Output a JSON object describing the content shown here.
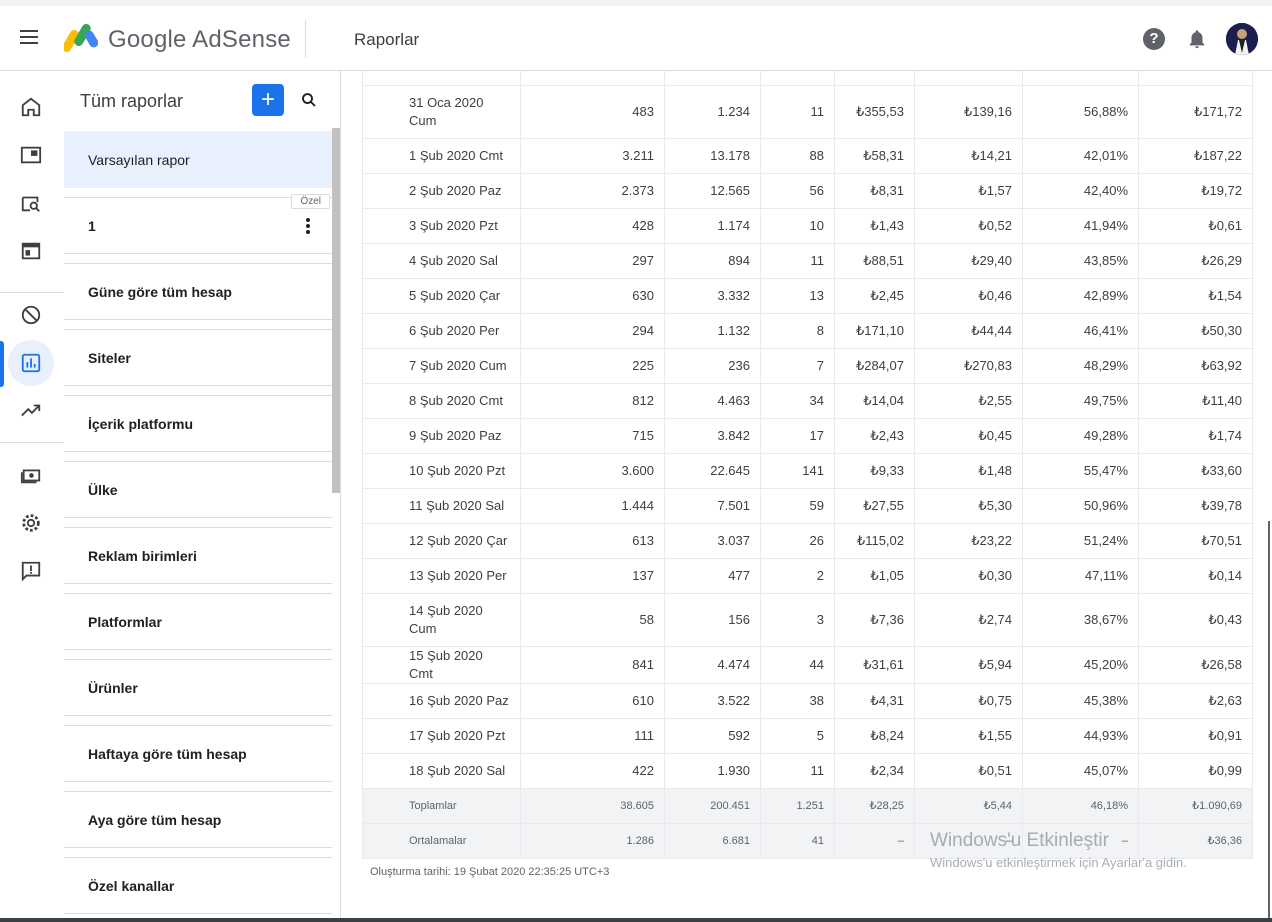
{
  "app": {
    "brand": "Google AdSense",
    "page_title": "Raporlar"
  },
  "icons": {
    "menu": "hamburger-menu-icon",
    "help": "help-icon",
    "notifications": "bell-icon",
    "avatar": "user-avatar"
  },
  "colors": {
    "accent": "#1a73e8",
    "selected_bg": "#e8f0fe",
    "summary_bg": "#f1f3f4"
  },
  "rail": {
    "items": [
      {
        "name": "home-icon"
      },
      {
        "name": "ads-icon"
      },
      {
        "name": "site-management-icon"
      },
      {
        "name": "content-icon"
      },
      {
        "name": "blocking-controls-icon"
      },
      {
        "name": "reports-icon",
        "active": true
      },
      {
        "name": "optimization-icon"
      },
      {
        "name": "payments-icon"
      },
      {
        "name": "settings-icon"
      },
      {
        "name": "feedback-icon"
      }
    ]
  },
  "reports_panel": {
    "title": "Tüm raporlar",
    "add_label": "+",
    "custom_badge": "Özel",
    "items": [
      "Varsayılan rapor",
      "1",
      "Güne göre tüm hesap",
      "Siteler",
      "İçerik platformu",
      "Ülke",
      "Reklam birimleri",
      "Platformlar",
      "Ürünler",
      "Haftaya göre tüm hesap",
      "Aya göre tüm hesap",
      "Özel kanallar"
    ]
  },
  "table": {
    "rows": [
      [
        "31 Oca 2020 Cum",
        "483",
        "1.234",
        "11",
        "₺355,53",
        "₺139,16",
        "56,88%",
        "₺171,72"
      ],
      [
        "1 Şub 2020 Cmt",
        "3.211",
        "13.178",
        "88",
        "₺58,31",
        "₺14,21",
        "42,01%",
        "₺187,22"
      ],
      [
        "2 Şub 2020 Paz",
        "2.373",
        "12.565",
        "56",
        "₺8,31",
        "₺1,57",
        "42,40%",
        "₺19,72"
      ],
      [
        "3 Şub 2020 Pzt",
        "428",
        "1.174",
        "10",
        "₺1,43",
        "₺0,52",
        "41,94%",
        "₺0,61"
      ],
      [
        "4 Şub 2020 Sal",
        "297",
        "894",
        "11",
        "₺88,51",
        "₺29,40",
        "43,85%",
        "₺26,29"
      ],
      [
        "5 Şub 2020 Çar",
        "630",
        "3.332",
        "13",
        "₺2,45",
        "₺0,46",
        "42,89%",
        "₺1,54"
      ],
      [
        "6 Şub 2020 Per",
        "294",
        "1.132",
        "8",
        "₺171,10",
        "₺44,44",
        "46,41%",
        "₺50,30"
      ],
      [
        "7 Şub 2020 Cum",
        "225",
        "236",
        "7",
        "₺284,07",
        "₺270,83",
        "48,29%",
        "₺63,92"
      ],
      [
        "8 Şub 2020 Cmt",
        "812",
        "4.463",
        "34",
        "₺14,04",
        "₺2,55",
        "49,75%",
        "₺11,40"
      ],
      [
        "9 Şub 2020 Paz",
        "715",
        "3.842",
        "17",
        "₺2,43",
        "₺0,45",
        "49,28%",
        "₺1,74"
      ],
      [
        "10 Şub 2020 Pzt",
        "3.600",
        "22.645",
        "141",
        "₺9,33",
        "₺1,48",
        "55,47%",
        "₺33,60"
      ],
      [
        "11 Şub 2020 Sal",
        "1.444",
        "7.501",
        "59",
        "₺27,55",
        "₺5,30",
        "50,96%",
        "₺39,78"
      ],
      [
        "12 Şub 2020 Çar",
        "613",
        "3.037",
        "26",
        "₺115,02",
        "₺23,22",
        "51,24%",
        "₺70,51"
      ],
      [
        "13 Şub 2020 Per",
        "137",
        "477",
        "2",
        "₺1,05",
        "₺0,30",
        "47,11%",
        "₺0,14"
      ],
      [
        "14 Şub 2020 Cum",
        "58",
        "156",
        "3",
        "₺7,36",
        "₺2,74",
        "38,67%",
        "₺0,43"
      ],
      [
        "15 Şub 2020 Cmt",
        "841",
        "4.474",
        "44",
        "₺31,61",
        "₺5,94",
        "45,20%",
        "₺26,58"
      ],
      [
        "16 Şub 2020 Paz",
        "610",
        "3.522",
        "38",
        "₺4,31",
        "₺0,75",
        "45,38%",
        "₺2,63"
      ],
      [
        "17 Şub 2020 Pzt",
        "111",
        "592",
        "5",
        "₺8,24",
        "₺1,55",
        "44,93%",
        "₺0,91"
      ],
      [
        "18 Şub 2020 Sal",
        "422",
        "1.930",
        "11",
        "₺2,34",
        "₺0,51",
        "45,07%",
        "₺0,99"
      ]
    ],
    "totals": [
      "Toplamlar",
      "38.605",
      "200.451",
      "1.251",
      "₺28,25",
      "₺5,44",
      "46,18%",
      "₺1.090,69"
    ],
    "averages": [
      "Ortalamalar",
      "1.286",
      "6.681",
      "41",
      "–",
      "–",
      "–",
      "₺36,36"
    ]
  },
  "created_text": "Oluşturma tarihi: 19 Şubat 2020 22:35:25 UTC+3",
  "watermark": {
    "line1": "Windows'u Etkinleştir",
    "line2": "Windows'u etkinleştirmek için Ayarlar'a gidin."
  }
}
